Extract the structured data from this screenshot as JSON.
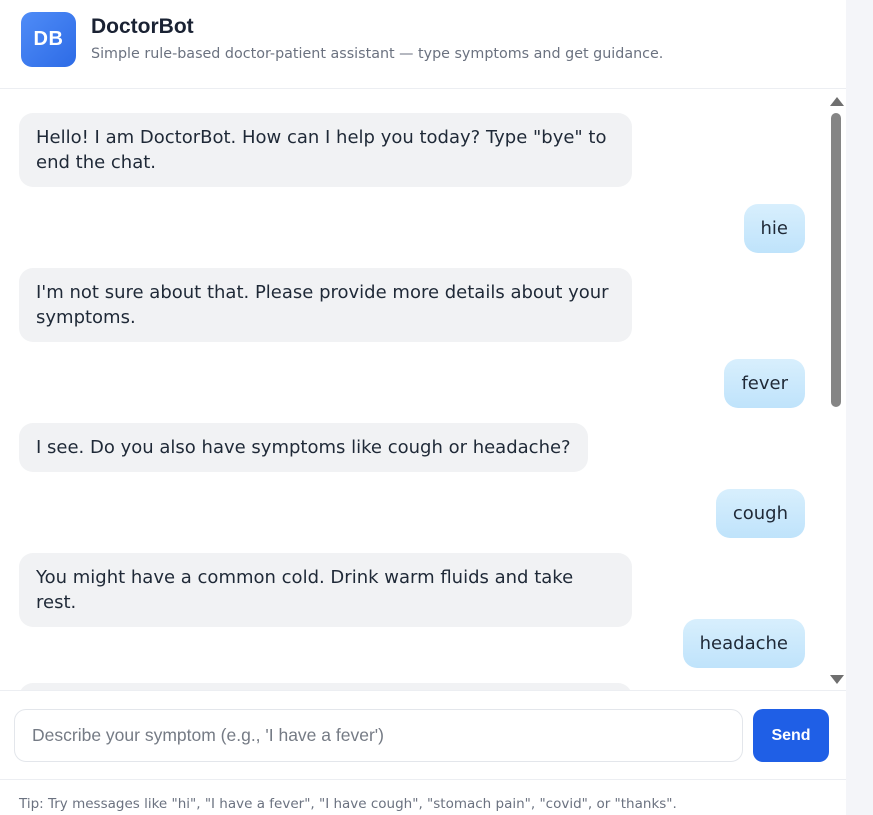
{
  "header": {
    "logo_text": "DB",
    "title": "DoctorBot",
    "subtitle": "Simple rule-based doctor-patient assistant — type symptoms and get guidance."
  },
  "messages": [
    {
      "sender": "bot",
      "text": "Hello! I am DoctorBot. How can I help you today? Type \"bye\" to end the chat."
    },
    {
      "sender": "user",
      "text": "hie"
    },
    {
      "sender": "bot",
      "text": "I'm not sure about that. Please provide more details about your symptoms."
    },
    {
      "sender": "user",
      "text": "fever"
    },
    {
      "sender": "bot",
      "text": "I see. Do you also have symptoms like cough or headache?"
    },
    {
      "sender": "user",
      "text": "cough"
    },
    {
      "sender": "bot",
      "text": "You might have a common cold. Drink warm fluids and take rest."
    },
    {
      "sender": "user",
      "text": "headache"
    }
  ],
  "composer": {
    "placeholder": "Describe your symptom (e.g., 'I have a fever')",
    "value": "",
    "send_label": "Send"
  },
  "tip": "Tip: Try messages like \"hi\", \"I have a fever\", \"I have cough\", \"stomach pain\", \"covid\", or \"thanks\".",
  "colors": {
    "accent": "#1f5fe6",
    "user_bubble": "#cde9fc",
    "bot_bubble": "#f1f2f4"
  }
}
